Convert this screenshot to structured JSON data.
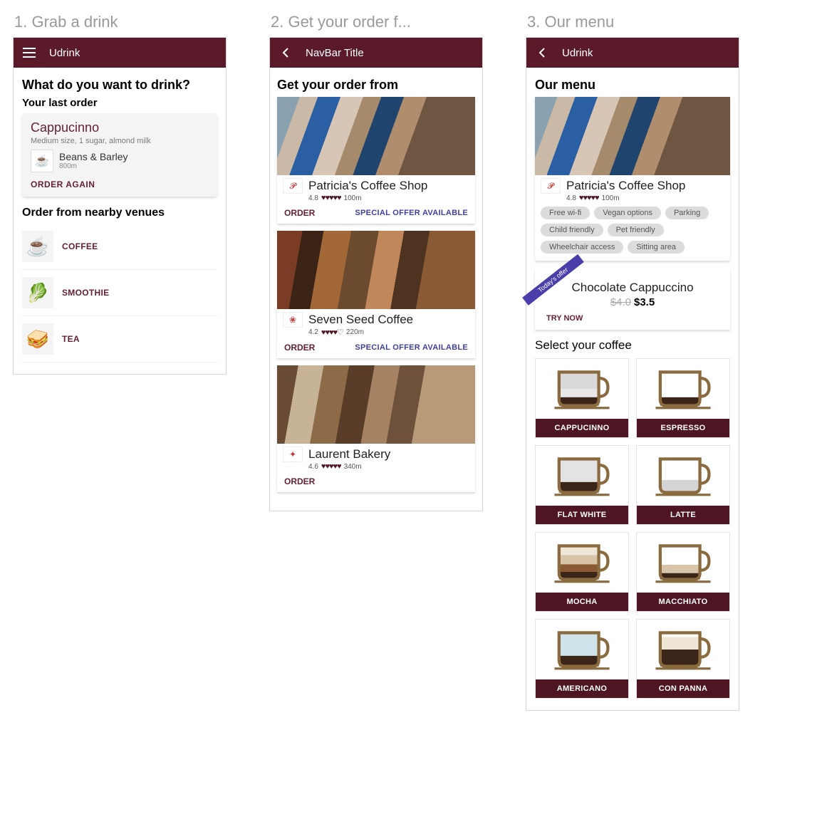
{
  "columns": [
    {
      "title": "1. Grab a drink"
    },
    {
      "title": "2. Get your order f..."
    },
    {
      "title": "3. Our menu"
    }
  ],
  "s1": {
    "nav": {
      "title": "Udrink"
    },
    "heading": "What do you want to drink?",
    "last_order_heading": "Your last order",
    "last_order": {
      "name": "Cappucinno",
      "desc": "Medium size, 1 sugar, almond milk",
      "venue": "Beans & Barley",
      "distance": "800m",
      "action": "ORDER AGAIN"
    },
    "nearby_heading": "Order from nearby venues",
    "categories": [
      {
        "label": "COFFEE",
        "emoji": "☕"
      },
      {
        "label": "SMOOTHIE",
        "emoji": "🥬"
      },
      {
        "label": "TEA",
        "emoji": "🥪"
      }
    ]
  },
  "s2": {
    "nav": {
      "title": "NavBar Title"
    },
    "heading": "Get your order from",
    "order_label": "ORDER",
    "special_label": "SPECIAL OFFER AVAILABLE",
    "venues": [
      {
        "name": "Patricia's Coffee Shop",
        "rating": "4.8",
        "distance": "100m",
        "hearts": "♥♥♥♥♥",
        "has_special": true,
        "hero": "hero-a",
        "logo": "𝓟"
      },
      {
        "name": "Seven Seed Coffee",
        "rating": "4.2",
        "distance": "220m",
        "hearts": "♥♥♥♥♡",
        "has_special": true,
        "hero": "hero-b",
        "logo": "❀"
      },
      {
        "name": "Laurent Bakery",
        "rating": "4.6",
        "distance": "340m",
        "hearts": "♥♥♥♥♥",
        "has_special": false,
        "hero": "hero-c",
        "logo": "✦"
      }
    ]
  },
  "s3": {
    "nav": {
      "title": "Udrink"
    },
    "heading": "Our menu",
    "shop": {
      "name": "Patricia's Coffee Shop",
      "rating": "4.8",
      "distance": "100m",
      "hearts": "♥♥♥♥♥",
      "logo": "𝓟"
    },
    "tags": [
      "Free wi-fi",
      "Vegan options",
      "Parking",
      "Child friendly",
      "Pet friendly",
      "Wheelchair access",
      "Sitting area"
    ],
    "offer": {
      "ribbon": "Today's offer",
      "name": "Chocolate Cappuccino",
      "old_price": "$4.0",
      "price": "$3.5",
      "action": "TRY NOW"
    },
    "select_heading": "Select your coffee",
    "coffees": [
      {
        "label": "CAPPUCINNO",
        "layers": [
          [
            "#d9d9d9",
            40
          ],
          [
            "#e8e8e8",
            20
          ],
          [
            "#3a2518",
            20
          ]
        ]
      },
      {
        "label": "ESPRESSO",
        "layers": [
          [
            "#ffffff",
            60
          ],
          [
            "#3a2518",
            20
          ]
        ]
      },
      {
        "label": "FLAT WHITE",
        "layers": [
          [
            "#e3e3e3",
            55
          ],
          [
            "#3a2518",
            25
          ]
        ]
      },
      {
        "label": "LATTE",
        "layers": [
          [
            "#ffffff",
            50
          ],
          [
            "#d4d4d4",
            30
          ]
        ]
      },
      {
        "label": "MOCHA",
        "layers": [
          [
            "#f0e6d8",
            22
          ],
          [
            "#d8c4a8",
            22
          ],
          [
            "#8a5a34",
            18
          ],
          [
            "#3a2518",
            18
          ]
        ]
      },
      {
        "label": "MACCHIATO",
        "layers": [
          [
            "#ffffff",
            45
          ],
          [
            "#d8c4a8",
            20
          ],
          [
            "#3a2518",
            15
          ]
        ]
      },
      {
        "label": "AMERICANO",
        "layers": [
          [
            "#cfe3ea",
            55
          ],
          [
            "#3a2518",
            25
          ]
        ]
      },
      {
        "label": "CON PANNA",
        "layers": [
          [
            "#ffffff",
            10
          ],
          [
            "#efe6d6",
            30
          ],
          [
            "#3a2518",
            40
          ]
        ]
      }
    ]
  }
}
